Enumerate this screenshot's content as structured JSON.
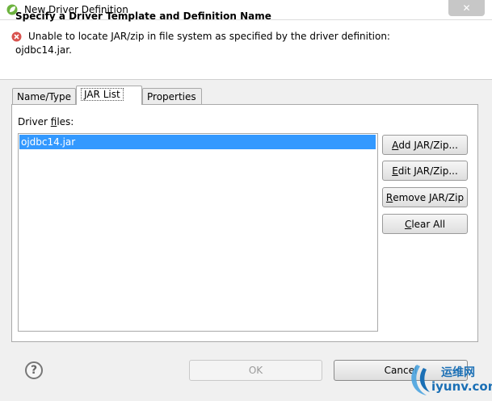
{
  "window": {
    "title": "New Driver Definition",
    "close_glyph": "✕"
  },
  "header": {
    "title": "Specify a Driver Template and Definition Name",
    "error_line1": "Unable to locate JAR/zip in file system as specified by the driver definition:",
    "error_line2": "ojdbc14.jar."
  },
  "tabs": [
    {
      "label": "Name/Type"
    },
    {
      "label": "JAR List"
    },
    {
      "label": "Properties"
    }
  ],
  "jar_list": {
    "label_prefix": "Driver ",
    "label_mnemonic": "f",
    "label_suffix": "iles:",
    "items": [
      "ojdbc14.jar"
    ]
  },
  "buttons": {
    "add": {
      "mnemonic": "A",
      "rest": "dd JAR/Zip..."
    },
    "edit": {
      "mnemonic": "E",
      "rest": "dit JAR/Zip..."
    },
    "remove": {
      "mnemonic": "R",
      "rest": "emove JAR/Zip"
    },
    "clear": {
      "mnemonic": "C",
      "rest": "lear All"
    }
  },
  "footer": {
    "help_glyph": "?",
    "ok": "OK",
    "cancel": "Cancel"
  },
  "watermark": {
    "top": "运维网",
    "bottom": "iyunv.com"
  },
  "colors": {
    "selection": "#3399ff",
    "error": "#d9534f",
    "watermark": "#1a6fb5"
  }
}
